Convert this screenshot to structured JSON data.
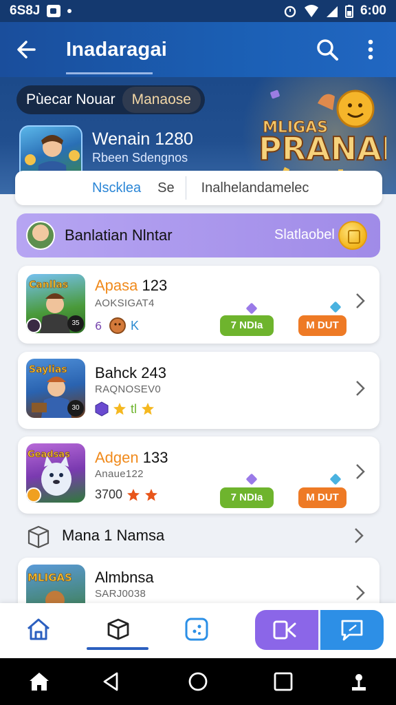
{
  "status_bar": {
    "time_left": "6S8J",
    "time_right": "6:00"
  },
  "header": {
    "title": "Inadaragai"
  },
  "banner": {
    "tabs": [
      "Pùecar Nouar",
      "Manaose"
    ],
    "logo_text_top": "MLIGAS",
    "logo_text_main": "PRANAL",
    "featured_title": "Wenain 1280",
    "featured_sub": "Rbeen Sdengnos"
  },
  "sort_bar": {
    "options": [
      "Nscklea",
      "Se",
      "Inalhelandamelec"
    ]
  },
  "promo": {
    "label": "Banlatian Nlntar",
    "right_text": "Slatlaobel"
  },
  "games": [
    {
      "title_accent": "Apasa",
      "title_rest": " 123",
      "sub": "AOKSIGAT4",
      "meta": "6 ● K",
      "btn_green": "7 NDIa",
      "btn_orange": "M DUT",
      "icon_text": "Canllas",
      "badge": "35"
    },
    {
      "title_accent": "",
      "title_rest": "Bahck 243",
      "sub": "RAQNOSEV0",
      "meta": "★ tl ★",
      "icon_text": "Saylias",
      "badge": "30"
    },
    {
      "title_accent": "Adgen",
      "title_rest": " 133",
      "sub": "Anaue122",
      "meta": "3700",
      "btn_green": "7 NDIa",
      "btn_orange": "M DUT",
      "icon_text": "Geadsas"
    },
    {
      "title_accent": "",
      "title_rest": "Almbnsa",
      "sub": "SARJ0038",
      "icon_text": "MLIGAS"
    }
  ],
  "plain_row": {
    "label": "Mana 1 Namsa"
  },
  "colors": {
    "header": "#1b5fb4",
    "accent_orange": "#ee7a25",
    "accent_green": "#6eb42d",
    "promo": "#a08be8"
  }
}
